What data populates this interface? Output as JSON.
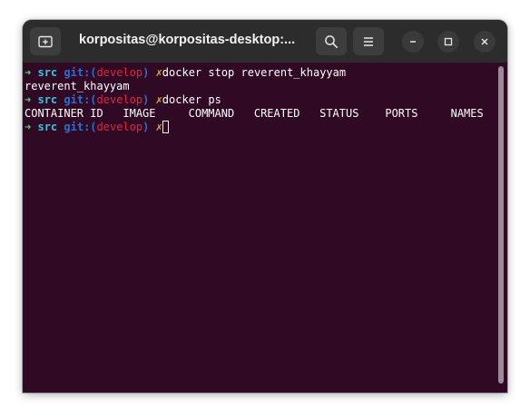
{
  "window": {
    "title": "korpositas@korpositas-desktop:..."
  },
  "icons": {
    "new_tab": "new-tab-icon",
    "search": "search-icon",
    "menu": "hamburger-menu-icon",
    "minimize": "minimize-icon",
    "maximize": "maximize-icon",
    "close": "close-icon"
  },
  "prompt": {
    "arrow": "➜",
    "dir": "src",
    "git_label": "git:(",
    "branch": "develop",
    "git_close": ")",
    "dirty": "✗"
  },
  "lines": [
    {
      "type": "prompt",
      "command": "docker stop reverent_khayyam"
    },
    {
      "type": "output",
      "text": "reverent_khayyam"
    },
    {
      "type": "prompt",
      "command": "docker ps"
    },
    {
      "type": "output",
      "text": "CONTAINER ID   IMAGE     COMMAND   CREATED   STATUS    PORTS     NAMES"
    },
    {
      "type": "prompt",
      "command": ""
    }
  ],
  "colors": {
    "terminal_bg": "#300a24",
    "titlebar_bg": "#2c2c2c",
    "prompt_arrow": "#4fd67a",
    "prompt_dir": "#33c7de",
    "prompt_git": "#2a6fd6",
    "prompt_branch": "#e0263b",
    "prompt_dirty": "#e3b14a"
  }
}
